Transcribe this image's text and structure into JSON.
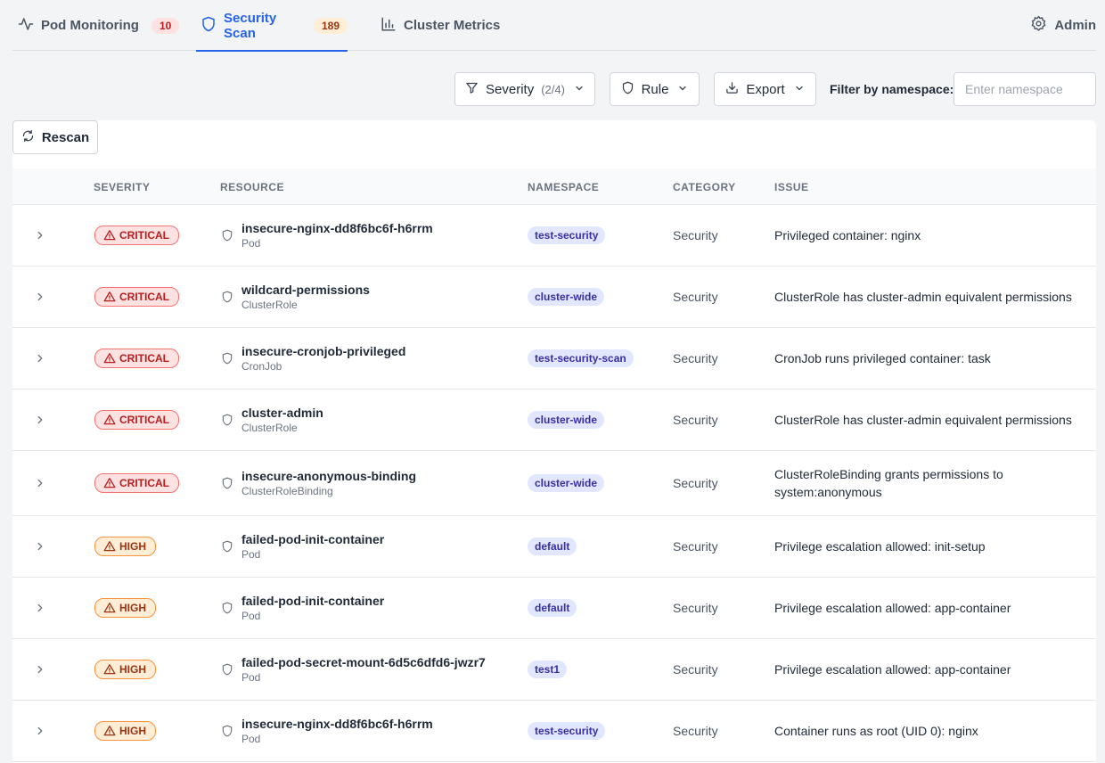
{
  "nav": {
    "tabs": [
      {
        "label": "Pod Monitoring",
        "count": "10"
      },
      {
        "label": "Security Scan",
        "count": "189"
      },
      {
        "label": "Cluster Metrics"
      }
    ],
    "admin_label": "Admin"
  },
  "filters": {
    "severity_label": "Severity",
    "severity_count": "(2/4)",
    "rule_label": "Rule",
    "export_label": "Export",
    "namespace_label": "Filter by namespace:",
    "namespace_placeholder": "Enter namespace",
    "namespace_value": ""
  },
  "toolbar": {
    "rescan_label": "Rescan"
  },
  "table": {
    "headers": [
      "SEVERITY",
      "RESOURCE",
      "NAMESPACE",
      "CATEGORY",
      "ISSUE"
    ],
    "rows": [
      {
        "severity": "CRITICAL",
        "resource": "insecure-nginx-dd8f6bc6f-h6rrm",
        "kind": "Pod",
        "namespace": "test-security",
        "category": "Security",
        "issue": "Privileged container: nginx"
      },
      {
        "severity": "CRITICAL",
        "resource": "wildcard-permissions",
        "kind": "ClusterRole",
        "namespace": "cluster-wide",
        "category": "Security",
        "issue": "ClusterRole has cluster-admin equivalent permissions"
      },
      {
        "severity": "CRITICAL",
        "resource": "insecure-cronjob-privileged",
        "kind": "CronJob",
        "namespace": "test-security-scan",
        "category": "Security",
        "issue": "CronJob runs privileged container: task"
      },
      {
        "severity": "CRITICAL",
        "resource": "cluster-admin",
        "kind": "ClusterRole",
        "namespace": "cluster-wide",
        "category": "Security",
        "issue": "ClusterRole has cluster-admin equivalent permissions"
      },
      {
        "severity": "CRITICAL",
        "resource": "insecure-anonymous-binding",
        "kind": "ClusterRoleBinding",
        "namespace": "cluster-wide",
        "category": "Security",
        "issue": "ClusterRoleBinding grants permissions to system:anonymous"
      },
      {
        "severity": "HIGH",
        "resource": "failed-pod-init-container",
        "kind": "Pod",
        "namespace": "default",
        "category": "Security",
        "issue": "Privilege escalation allowed: init-setup"
      },
      {
        "severity": "HIGH",
        "resource": "failed-pod-init-container",
        "kind": "Pod",
        "namespace": "default",
        "category": "Security",
        "issue": "Privilege escalation allowed: app-container"
      },
      {
        "severity": "HIGH",
        "resource": "failed-pod-secret-mount-6d5c6dfd6-jwzr7",
        "kind": "Pod",
        "namespace": "test1",
        "category": "Security",
        "issue": "Privilege escalation allowed: app-container"
      },
      {
        "severity": "HIGH",
        "resource": "insecure-nginx-dd8f6bc6f-h6rrm",
        "kind": "Pod",
        "namespace": "test-security",
        "category": "Security",
        "issue": "Container runs as root (UID 0): nginx"
      }
    ]
  },
  "colors": {
    "accent": "#2563eb",
    "critical": "#b91c1c",
    "high": "#9a3412",
    "namespace_pill": "#3730a3"
  }
}
